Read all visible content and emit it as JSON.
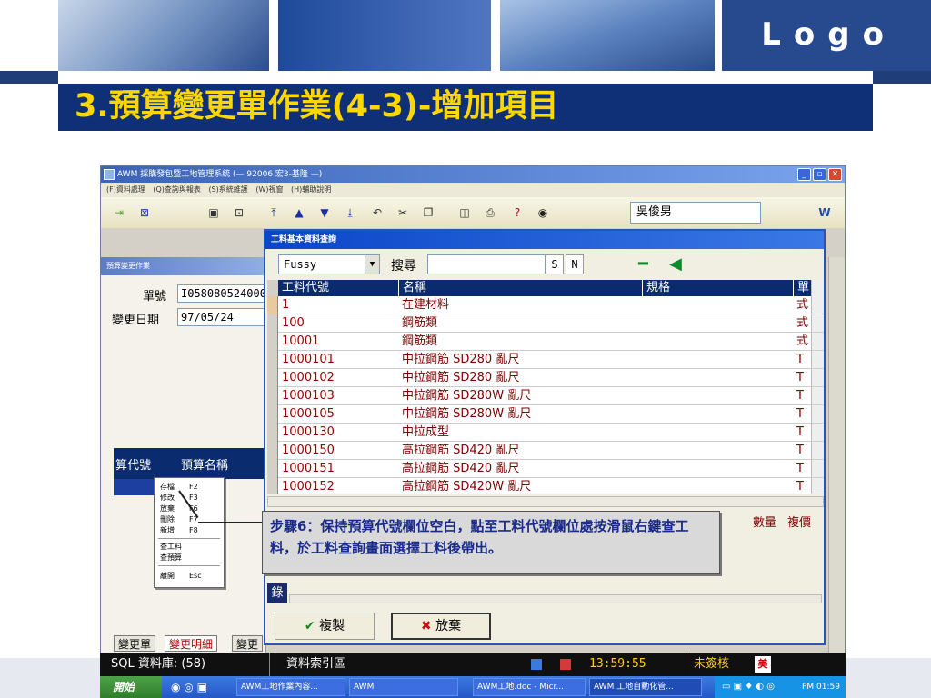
{
  "slide": {
    "logo": "Logo",
    "title": "3.預算變更單作業(4-3)-增加項目"
  },
  "window": {
    "title": "AWM 採購發包暨工地管理系統 (— 92006 宏3-基隆 —)",
    "menu": "(F)資料處理 (Q)查詢與報表 (S)系統維護 (W)視窗 (H)輔助說明",
    "user": "吳俊男",
    "controls": {
      "min": "_",
      "max": "▫",
      "close": "✕"
    }
  },
  "left_panel": {
    "title": "預算變更作業",
    "order_label": "單號",
    "order_value": "I0580805240001",
    "date_label": "變更日期",
    "date_value": "97/05/24",
    "grid_headers": [
      "算代號",
      "預算名稱"
    ],
    "context_menu": [
      {
        "label": "存檔",
        "key": "F2"
      },
      {
        "label": "修改",
        "key": "F3"
      },
      {
        "label": "放棄",
        "key": "F6"
      },
      {
        "label": "刪除",
        "key": "F7"
      },
      {
        "label": "新增",
        "key": "F8"
      },
      {
        "label": "查工料",
        "key": ""
      },
      {
        "label": "查預算",
        "key": ""
      },
      {
        "label": "離開",
        "key": "Esc"
      }
    ],
    "tabs": [
      "變更單",
      "變更明細",
      "變更"
    ],
    "leave_button": "離開"
  },
  "dialog": {
    "title": "工料基本資料查詢",
    "mode": "Fussy",
    "search_label": "搜尋",
    "search_value": "",
    "btn_s": "S",
    "btn_n": "N",
    "columns": [
      "工料代號",
      "名稱",
      "規格",
      "單"
    ],
    "rows": [
      {
        "code": "1",
        "name": "在建材料",
        "spec": "",
        "unit": "式"
      },
      {
        "code": "100",
        "name": "鋼筋類",
        "spec": "",
        "unit": "式"
      },
      {
        "code": "10001",
        "name": "鋼筋類",
        "spec": "",
        "unit": "式"
      },
      {
        "code": "1000101",
        "name": "中拉鋼筋 SD280 亂尺",
        "spec": "",
        "unit": "T"
      },
      {
        "code": "1000102",
        "name": "中拉鋼筋 SD280 亂尺",
        "spec": "",
        "unit": "T"
      },
      {
        "code": "1000103",
        "name": "中拉鋼筋 SD280W 亂尺",
        "spec": "",
        "unit": "T"
      },
      {
        "code": "1000105",
        "name": "中拉鋼筋 SD280W 亂尺",
        "spec": "",
        "unit": "T"
      },
      {
        "code": "1000130",
        "name": "中拉成型",
        "spec": "",
        "unit": "T"
      },
      {
        "code": "1000150",
        "name": "高拉鋼筋 SD420 亂尺",
        "spec": "",
        "unit": "T"
      },
      {
        "code": "1000151",
        "name": "高拉鋼筋 SD420 亂尺",
        "spec": "",
        "unit": "T"
      },
      {
        "code": "1000152",
        "name": "高拉鋼筋 SD420W 亂尺",
        "spec": "",
        "unit": "T"
      }
    ],
    "lower_headers": [
      "數量",
      "複價"
    ],
    "side_label": "錄",
    "copy_button": "複製",
    "discard_button": "放棄"
  },
  "callout": "步驟6：保持預算代號欄位空白，點至工料代號欄位處按滑鼠右鍵查工料，於工料查詢畫面選擇工料後帶出。",
  "status_bar": {
    "db": "SQL 資料庫: (58)",
    "index": "資料索引區",
    "time": "13:59:55",
    "state": "未簽核",
    "mark": "美"
  },
  "taskbar": {
    "start": "開始",
    "items": [
      "AWM工地作業內容...",
      "AWM",
      "AWM工地.doc - Micr...",
      "AWM 工地自動化管..."
    ],
    "clock": "PM 01:59"
  },
  "colors": {
    "title_bg": "#0f2f77",
    "title_text": "#ffd700",
    "grid_header": "#0a2b6e"
  }
}
